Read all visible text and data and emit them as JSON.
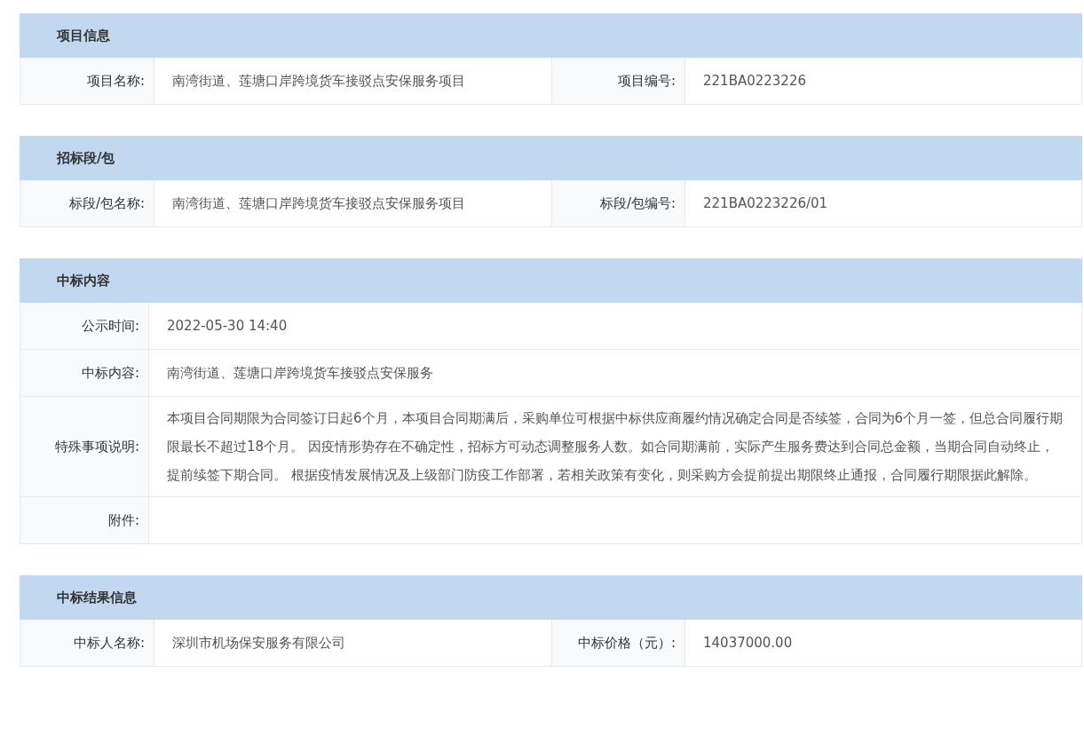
{
  "sections": [
    {
      "title": "项目信息",
      "kind": "pairs",
      "rows": [
        {
          "cells": [
            {
              "label": "项目名称:",
              "value": "南湾街道、莲塘口岸跨境货车接驳点安保服务项目"
            },
            {
              "label": "项目编号:",
              "value": "221BA0223226"
            }
          ]
        }
      ]
    },
    {
      "title": "招标段/包",
      "kind": "pairs",
      "rows": [
        {
          "cells": [
            {
              "label": "标段/包名称:",
              "value": "南湾街道、莲塘口岸跨境货车接驳点安保服务项目"
            },
            {
              "label": "标段/包编号:",
              "value": "221BA0223226/01"
            }
          ]
        }
      ]
    },
    {
      "title": "中标内容",
      "kind": "list",
      "rows": [
        {
          "label": "公示时间:",
          "value": "2022-05-30 14:40"
        },
        {
          "label": "中标内容:",
          "value": "南湾街道、莲塘口岸跨境货车接驳点安保服务"
        },
        {
          "label": "特殊事项说明:",
          "value": "本项目合同期限为合同签订日起6个月，本项目合同期满后，采购单位可根据中标供应商履约情况确定合同是否续签，合同为6个月一签，但总合同履行期限最长不超过18个月。 因疫情形势存在不确定性，招标方可动态调整服务人数。如合同期满前，实际产生服务费达到合同总金额，当期合同自动终止，提前续签下期合同。 根据疫情发展情况及上级部门防疫工作部署，若相关政策有变化，则采购方会提前提出期限终止通报，合同履行期限据此解除。"
        },
        {
          "label": "附件:"
        }
      ]
    },
    {
      "title": "中标结果信息",
      "kind": "pairs",
      "rows": [
        {
          "cells": [
            {
              "label": "中标人名称:",
              "value": "深圳市机场保安服务有限公司"
            },
            {
              "label": "中标价格（元）:",
              "value": "14037000.00"
            }
          ]
        }
      ]
    }
  ]
}
